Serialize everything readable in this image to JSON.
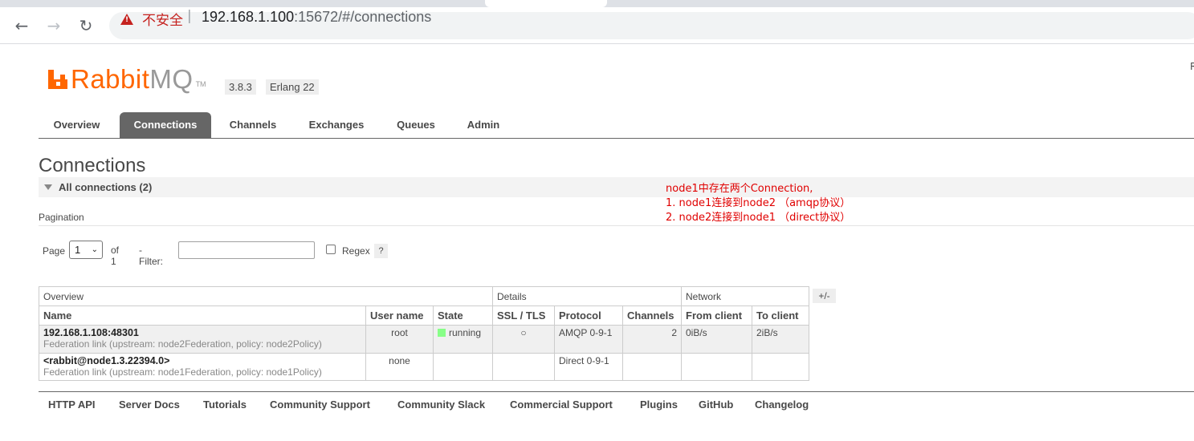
{
  "browser": {
    "insecure_label": "不安全",
    "url_host": "192.168.1.100",
    "url_rest": ":15672/#/connections"
  },
  "header": {
    "logo_rabbit": "Rabbit",
    "logo_mq": "MQ",
    "logo_tm": "TM",
    "version": "3.8.3",
    "erlang": "Erlang 22",
    "corner_text": "R"
  },
  "nav": {
    "items": [
      "Overview",
      "Connections",
      "Channels",
      "Exchanges",
      "Queues",
      "Admin"
    ],
    "selected": "Connections"
  },
  "page": {
    "title": "Connections",
    "section_label": "All connections (2)",
    "pagination_label": "Pagination"
  },
  "pager": {
    "page_label": "Page",
    "page_value": "1",
    "of_label": "of 1",
    "filter_label": "- Filter:",
    "regex_label": "Regex",
    "help_label": "?"
  },
  "annotation": {
    "line1": "node1中存在两个Connection,",
    "line2": "1. node1连接到node2 （amqp协议）",
    "line3": "2. node2连接到node1 （direct协议）"
  },
  "table": {
    "groups": [
      "Overview",
      "Details",
      "Network"
    ],
    "columns": [
      "Name",
      "User name",
      "State",
      "SSL / TLS",
      "Protocol",
      "Channels",
      "From client",
      "To client"
    ],
    "rows": [
      {
        "name": "192.168.1.108:48301",
        "sub": "Federation link (upstream: node2Federation, policy: node2Policy)",
        "user": "root",
        "state": "running",
        "ssl": "○",
        "protocol": "AMQP 0-9-1",
        "channels": "2",
        "from_client": "0iB/s",
        "to_client": "2iB/s"
      },
      {
        "name": "<rabbit@node1.3.22394.0>",
        "sub": "Federation link (upstream: node1Federation, policy: node1Policy)",
        "user": "none",
        "state": "",
        "ssl": "",
        "protocol": "Direct 0-9-1",
        "channels": "",
        "from_client": "",
        "to_client": ""
      }
    ],
    "plus_minus": "+/-"
  },
  "footer": {
    "links": [
      "HTTP API",
      "Server Docs",
      "Tutorials",
      "Community Support",
      "Community Slack",
      "Commercial Support",
      "Plugins",
      "GitHub",
      "Changelog"
    ]
  },
  "colors": {
    "brand": "#ff6600",
    "running": "#88ff88",
    "annotation": "#e00000"
  }
}
